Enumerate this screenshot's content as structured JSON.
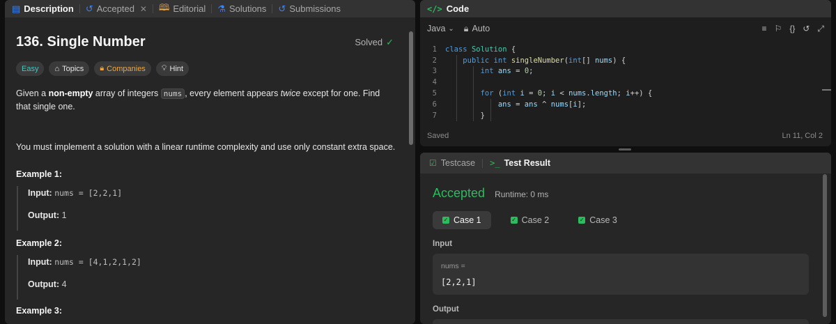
{
  "left_tabs": [
    {
      "label": "Description",
      "icon": "description-icon"
    },
    {
      "label": "Accepted",
      "icon": "history-icon"
    },
    {
      "label": "Editorial",
      "icon": "book-icon"
    },
    {
      "label": "Solutions",
      "icon": "flask-icon"
    },
    {
      "label": "Submissions",
      "icon": "history-icon"
    }
  ],
  "problem": {
    "title": "136. Single Number",
    "status": "Solved",
    "tags": {
      "difficulty": "Easy",
      "topics": "Topics",
      "companies": "Companies",
      "hint": "Hint"
    },
    "desc_1_pre": "Given a ",
    "desc_1_bold": "non-empty",
    "desc_1_mid": " array of integers ",
    "desc_1_code": "nums",
    "desc_1_mid2": ", every element appears ",
    "desc_1_em": "twice",
    "desc_1_post": " except for one. Find that single one.",
    "desc_2": "You must implement a solution with a linear runtime complexity and use only constant extra space.",
    "examples": [
      {
        "title": "Example 1:",
        "input_label": "Input:",
        "input_value": "nums = [2,2,1]",
        "output_label": "Output:",
        "output_value": "1"
      },
      {
        "title": "Example 2:",
        "input_label": "Input:",
        "input_value": "nums = [4,1,2,1,2]",
        "output_label": "Output:",
        "output_value": "4"
      },
      {
        "title": "Example 3:"
      }
    ]
  },
  "editor": {
    "header": "Code",
    "language": "Java",
    "auto": "Auto",
    "line_numbers": [
      "1",
      "2",
      "3",
      "4",
      "5",
      "6",
      "7"
    ],
    "status_left": "Saved",
    "status_right": "Ln 11, Col 2"
  },
  "result": {
    "tab_testcase": "Testcase",
    "tab_result": "Test Result",
    "verdict": "Accepted",
    "runtime": "Runtime: 0 ms",
    "cases": [
      "Case 1",
      "Case 2",
      "Case 3"
    ],
    "input_label": "Input",
    "input_var": "nums =",
    "input_value": "[2,2,1]",
    "output_label": "Output"
  },
  "colors": {
    "accent_green": "#2cbb5d",
    "easy": "#46c6c2",
    "companies": "#f0a741"
  }
}
